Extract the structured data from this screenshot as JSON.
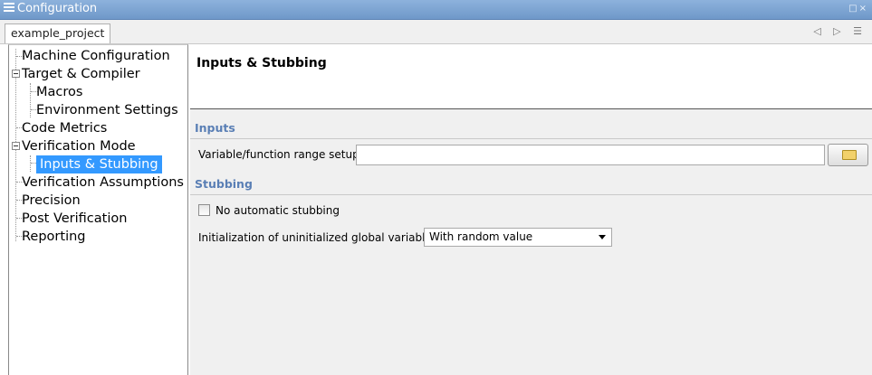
{
  "window": {
    "title": "Configuration",
    "icon": "document-icon",
    "controls": "□×"
  },
  "tabs": [
    {
      "label": "example_project"
    }
  ],
  "tab_nav": "◁ ▷ ☰",
  "tree": {
    "items": [
      {
        "label": "Machine Configuration"
      },
      {
        "label": "Target & Compiler"
      },
      {
        "label": "Macros"
      },
      {
        "label": "Environment Settings"
      },
      {
        "label": "Code Metrics"
      },
      {
        "label": "Verification Mode"
      },
      {
        "label": "Inputs & Stubbing"
      },
      {
        "label": "Verification Assumptions"
      },
      {
        "label": "Precision"
      },
      {
        "label": "Post Verification"
      },
      {
        "label": "Reporting"
      }
    ],
    "selected": "Inputs & Stubbing"
  },
  "panel": {
    "title": "Inputs & Stubbing",
    "inputs_section": "Inputs",
    "range_setup_label": "Variable/function range setup",
    "range_setup_value": "",
    "stubbing_section": "Stubbing",
    "no_auto_stub_label": "No automatic stubbing",
    "no_auto_stub_checked": false,
    "init_globals_label": "Initialization of uninitialized global variables",
    "init_globals_value": "With random value"
  },
  "colors": {
    "titlebar": "#7aa3d3",
    "selection": "#3399ff",
    "section_heading": "#5a7fb5"
  }
}
